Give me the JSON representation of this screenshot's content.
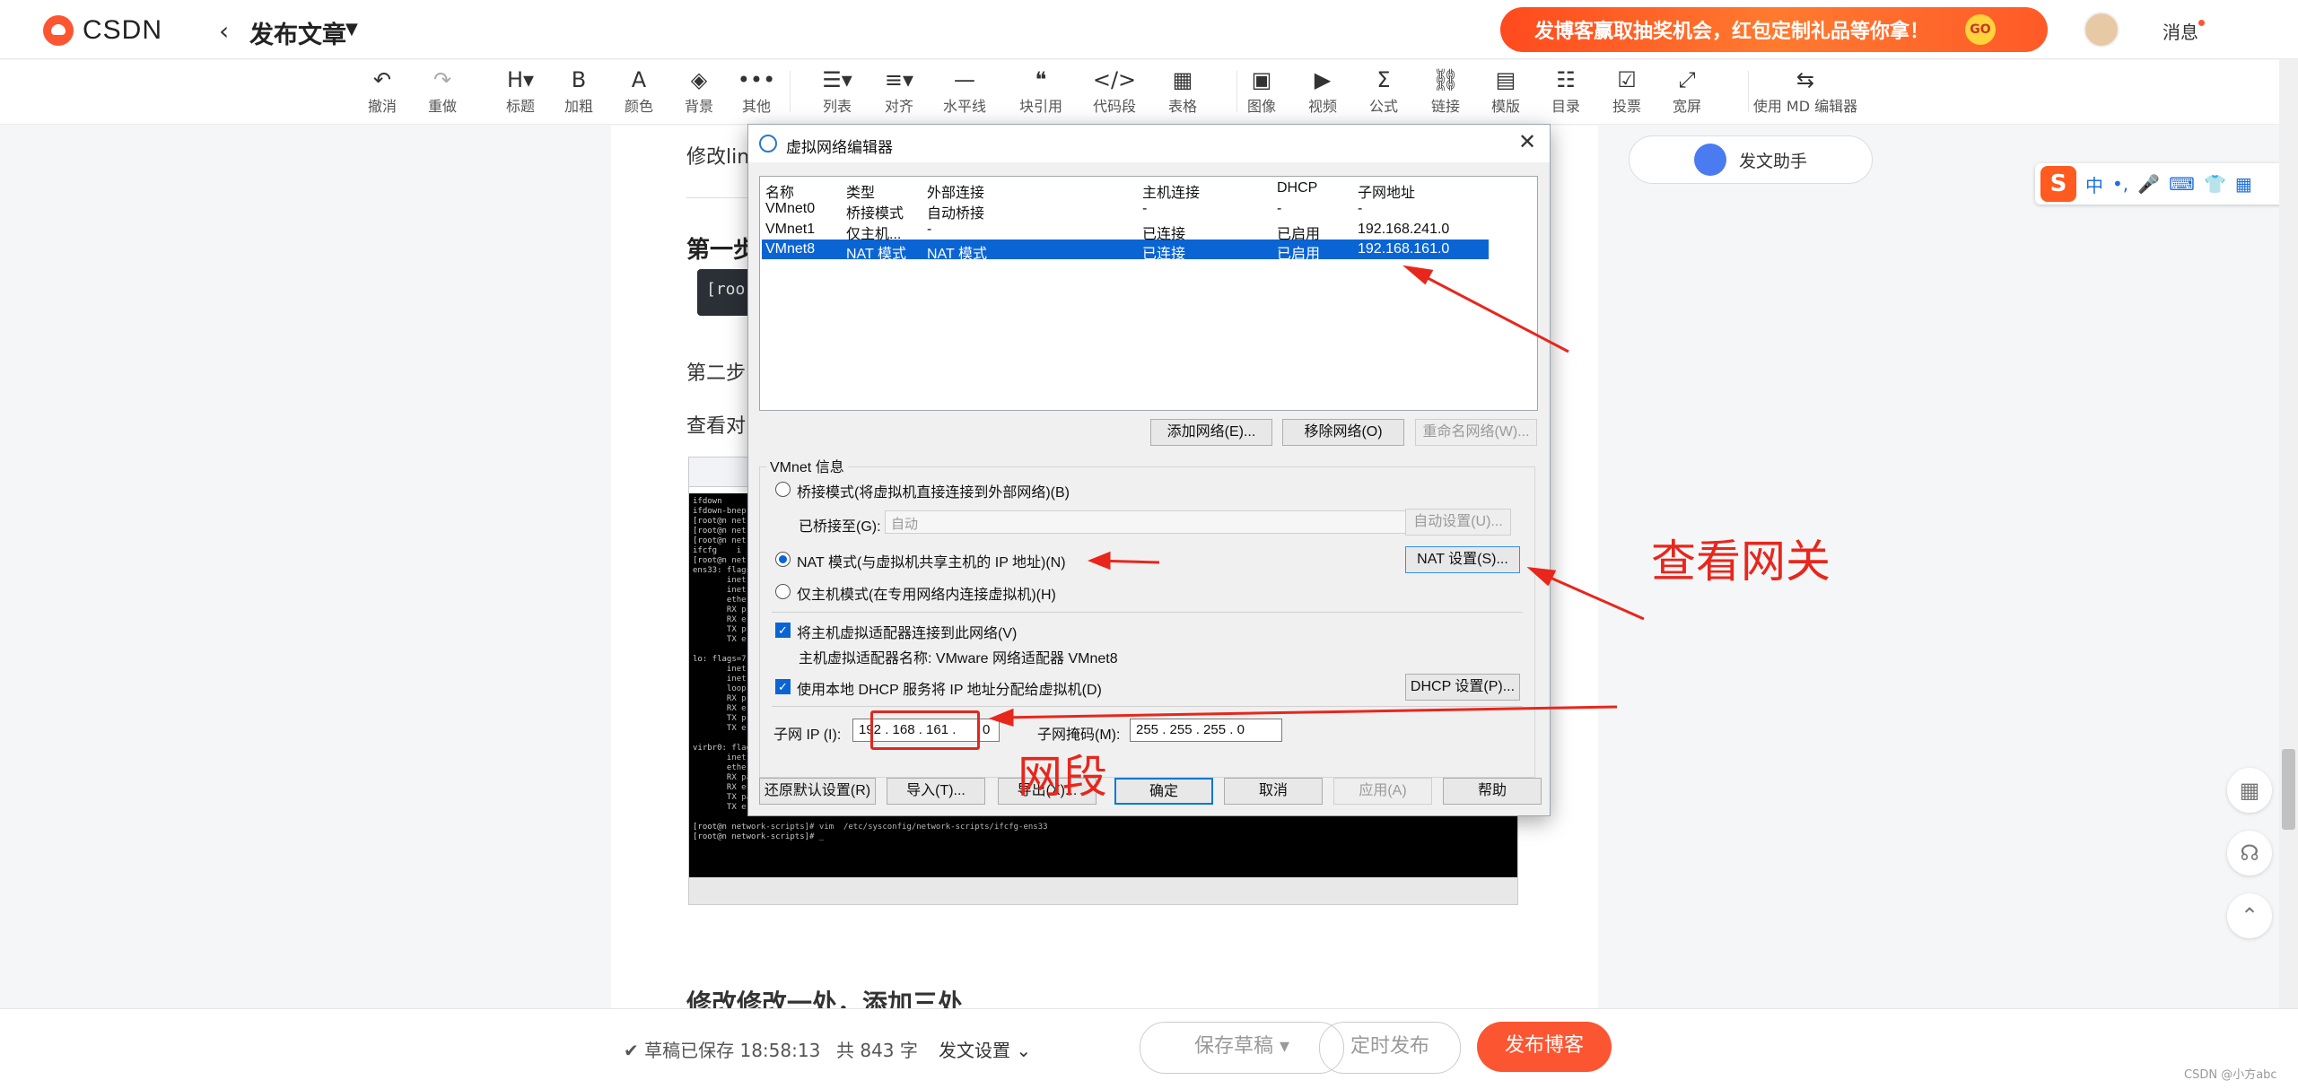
{
  "header": {
    "logo_text": "CSDN",
    "back_icon": "chevron-left-icon",
    "page_title": "发布文章",
    "promo_text": "发博客赢取抽奖机会，红包定制礼品等你拿！",
    "promo_badge": "GO",
    "messages_label": "消息"
  },
  "toolbar": {
    "items": [
      {
        "label": "撤消",
        "icon": "↶"
      },
      {
        "label": "重做",
        "icon": "↷"
      },
      {
        "label": "标题",
        "icon": "H▾"
      },
      {
        "label": "加粗",
        "icon": "B"
      },
      {
        "label": "颜色",
        "icon": "A"
      },
      {
        "label": "背景",
        "icon": "◈"
      },
      {
        "label": "其他",
        "icon": "•••"
      },
      {
        "label": "列表",
        "icon": "☰▾"
      },
      {
        "label": "对齐",
        "icon": "≡▾"
      },
      {
        "label": "水平线",
        "icon": "—"
      },
      {
        "label": "块引用",
        "icon": "❝"
      },
      {
        "label": "代码段",
        "icon": "</>"
      },
      {
        "label": "表格",
        "icon": "▦"
      },
      {
        "label": "图像",
        "icon": "▣"
      },
      {
        "label": "视频",
        "icon": "▶"
      },
      {
        "label": "公式",
        "icon": "Σ"
      },
      {
        "label": "链接",
        "icon": "⛓"
      },
      {
        "label": "模版",
        "icon": "▤"
      },
      {
        "label": "目录",
        "icon": "☷"
      },
      {
        "label": "投票",
        "icon": "☑"
      },
      {
        "label": "宽屏",
        "icon": "⤢"
      },
      {
        "label": "使用 MD 编辑器",
        "icon": "⇆"
      }
    ]
  },
  "editor": {
    "text1": "修改lin",
    "h2": "第一步",
    "code": "[roo",
    "text2": "第二步",
    "text3": "查看对",
    "bottom_heading": "修改修改一处，添加三处",
    "embed_terminal": "ifdown\nifdown-bnep\n[root@n net\n[root@n net\n[root@n net\nifcfg    i\n[root@n net\nens33: flags\n       inet\n       inet\n       ethe\n       RX p\n       RX e\n       TX p\n       TX e\n\nlo: flags=7\n       inet\n       inet\n       loop\n       RX p\n       RX e\n       TX p\n       TX e\n\nvirbr0: flag\n       inet\n       ether\n       RX packets 0  bytes 0 (0.0 B)\n       RX errors 0  dropped 0  overruns 0  frame 0\n       TX packets 0  bytes 0 (0.0 B)\n       TX errors 0  dropped 0 overruns 0  carrier 0  collisions 0\n\n[root@n network-scripts]# vim  /etc/sysconfig/network-scripts/ifcfg-ens33\n[root@n network-scripts]# _"
  },
  "right_panel": {
    "assistant_label": "发文助手",
    "ime_items": [
      "中",
      "•,",
      "🎤",
      "⌨",
      "👕",
      "▦"
    ]
  },
  "bottombar": {
    "save_status": "草稿已保存 18:58:13",
    "word_count": "共 843 字",
    "post_settings": "发文设置",
    "draft_button": "保存草稿",
    "schedule_button": "定时发布",
    "publish_button": "发布博客",
    "watermark": "CSDN @小方abc"
  },
  "dialog": {
    "title": "虚拟网络编辑器",
    "columns": [
      "名称",
      "类型",
      "外部连接",
      "主机连接",
      "DHCP",
      "子网地址"
    ],
    "rows": [
      [
        "VMnet0",
        "桥接模式",
        "自动桥接",
        "-",
        "-",
        "-"
      ],
      [
        "VMnet1",
        "仅主机...",
        "-",
        "已连接",
        "已启用",
        "192.168.241.0"
      ],
      [
        "VMnet8",
        "NAT 模式",
        "NAT 模式",
        "已连接",
        "已启用",
        "192.168.161.0"
      ]
    ],
    "add_network": "添加网络(E)...",
    "remove_network": "移除网络(O)",
    "rename_network": "重命名网络(W)...",
    "vmnet_info": "VMnet 信息",
    "bridge_mode": "桥接模式(将虚拟机直接连接到外部网络)(B)",
    "bridged_to_label": "已桥接至(G):",
    "bridged_to_value": "自动",
    "auto_settings": "自动设置(U)...",
    "nat_mode": "NAT 模式(与虚拟机共享主机的 IP 地址)(N)",
    "nat_settings": "NAT 设置(S)...",
    "host_only": "仅主机模式(在专用网络内连接虚拟机)(H)",
    "connect_adapter": "将主机虚拟适配器连接到此网络(V)",
    "adapter_name": "主机虚拟适配器名称: VMware 网络适配器 VMnet8",
    "use_dhcp": "使用本地 DHCP 服务将 IP 地址分配给虚拟机(D)",
    "dhcp_settings": "DHCP 设置(P)...",
    "subnet_ip_label": "子网 IP (I):",
    "subnet_ip": "192 . 168 . 161 .",
    "subnet_ip_last": "0",
    "subnet_mask_label": "子网掩码(M):",
    "subnet_mask": "255 . 255 . 255 .  0",
    "restore_defaults": "还原默认设置(R)",
    "import": "导入(T)...",
    "export": "导出(X)...",
    "ok": "确定",
    "cancel": "取消",
    "apply": "应用(A)",
    "help": "帮助"
  },
  "annotations": {
    "check_gateway": "查看网关",
    "segment": "网段",
    "color": "#e8261c"
  }
}
